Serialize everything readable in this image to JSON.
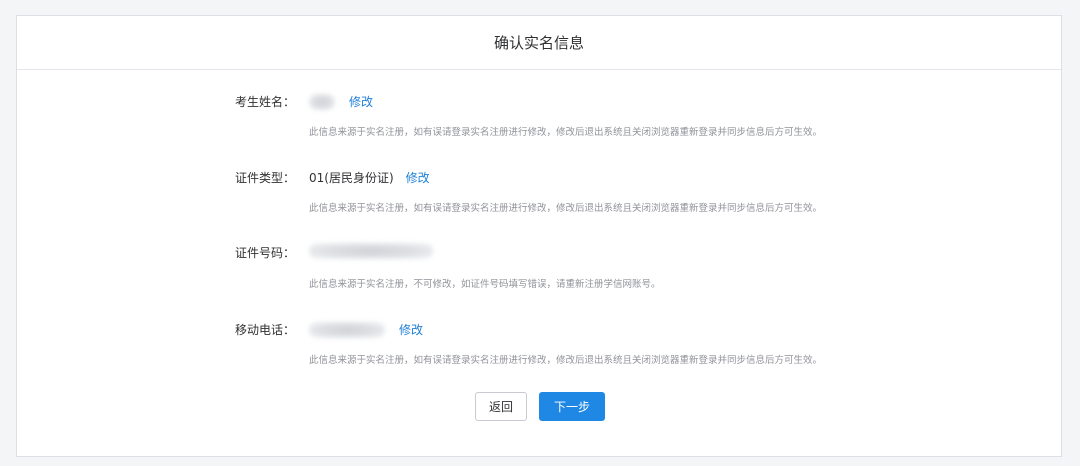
{
  "header": {
    "title": "确认实名信息"
  },
  "fields": {
    "name": {
      "label": "考生姓名：",
      "edit_label": "修改",
      "hint": "此信息来源于实名注册，如有误请登录实名注册进行修改，修改后退出系统且关闭浏览器重新登录并同步信息后方可生效。"
    },
    "id_type": {
      "label": "证件类型：",
      "value": "01(居民身份证)",
      "edit_label": "修改",
      "hint": "此信息来源于实名注册，如有误请登录实名注册进行修改，修改后退出系统且关闭浏览器重新登录并同步信息后方可生效。"
    },
    "id_number": {
      "label": "证件号码：",
      "hint": "此信息来源于实名注册，不可修改，如证件号码填写错误，请重新注册学信网账号。"
    },
    "mobile": {
      "label": "移动电话：",
      "edit_label": "修改",
      "hint": "此信息来源于实名注册，如有误请登录实名注册进行修改，修改后退出系统且关闭浏览器重新登录并同步信息后方可生效。"
    }
  },
  "actions": {
    "back_label": "返回",
    "next_label": "下一步"
  },
  "colors": {
    "link": "#1f7fd8",
    "primary": "#1f88e5"
  }
}
